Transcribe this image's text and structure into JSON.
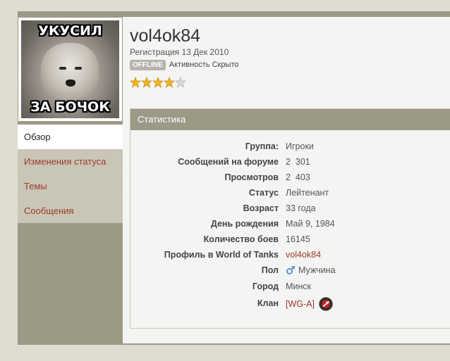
{
  "profile": {
    "username": "vol4ok84",
    "registration": "Регистрация 13 Дек 2010",
    "status_badge": "OFFLINE",
    "activity": "Активность Скрыто",
    "rating_stars": 4,
    "rating_max": 5,
    "avatar_caption_top": "УКУСИЛ",
    "avatar_caption_bottom": "ЗА БОЧОК"
  },
  "nav": {
    "items": [
      {
        "label": "Обзор",
        "active": true
      },
      {
        "label": "Изменения статуса",
        "active": false
      },
      {
        "label": "Темы",
        "active": false
      },
      {
        "label": "Сообщения",
        "active": false
      }
    ]
  },
  "stats": {
    "title": "Статистика",
    "rows": [
      {
        "key": "Группа:",
        "value": "Игроки"
      },
      {
        "key": "Сообщений на форуме",
        "value": "2  301"
      },
      {
        "key": "Просмотров",
        "value": "2  403"
      },
      {
        "key": "Статус",
        "value": "Лейтенант"
      },
      {
        "key": "Возраст",
        "value": "33 года"
      },
      {
        "key": "День рождения",
        "value": "Май 9, 1984"
      },
      {
        "key": "Количество боев",
        "value": "16145"
      },
      {
        "key": "Профиль в World of Tanks",
        "value": "vol4ok84"
      },
      {
        "key": "Пол",
        "value": "Мужчина"
      },
      {
        "key": "Город",
        "value": "Минск"
      },
      {
        "key": "Клан",
        "value": "[WG-A]"
      }
    ]
  },
  "colors": {
    "accent": "#9c9a86",
    "link": "#9b3a2c",
    "star": "#f0b429"
  },
  "icons": {
    "gender": "male-icon",
    "clan": "clan-emblem-icon"
  }
}
